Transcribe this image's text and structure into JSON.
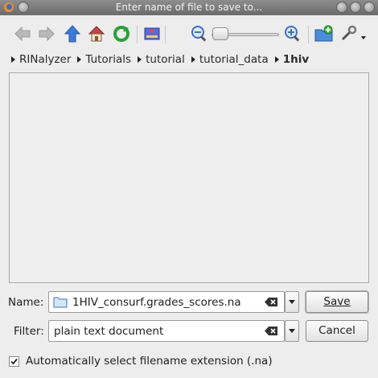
{
  "window": {
    "title": "Enter name of file to save to..."
  },
  "toolbar": {
    "buttons": [
      {
        "icon": "back-arrow-icon"
      },
      {
        "icon": "forward-arrow-icon"
      },
      {
        "icon": "up-arrow-icon"
      },
      {
        "icon": "home-icon"
      },
      {
        "icon": "reload-icon"
      },
      {
        "icon": "bookmarks-icon"
      },
      {
        "icon": "zoom-out-icon"
      },
      {
        "icon": "zoom-in-icon"
      },
      {
        "icon": "new-folder-icon"
      },
      {
        "icon": "tools-icon"
      }
    ],
    "zoom_level": 0.05
  },
  "breadcrumb": [
    "RINalyzer",
    "Tutorials",
    "tutorial",
    "tutorial_data",
    "1hiv"
  ],
  "name_field": {
    "label": "Name:",
    "value": "1HIV_consurf.grades_scores.na"
  },
  "filter_field": {
    "label": "Filter:",
    "value": "plain text document"
  },
  "buttons": {
    "save": "Save",
    "cancel": "Cancel"
  },
  "auto_extension": {
    "label": "Automatically select filename extension (.na)",
    "checked": true
  },
  "colors": {
    "titlebar": "#7a7a7a",
    "accent_blue": "#2e6fd0",
    "reload_green": "#2aa03a"
  }
}
